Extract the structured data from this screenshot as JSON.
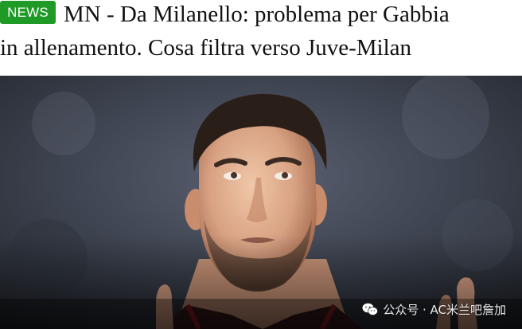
{
  "article": {
    "badge": "NEWS",
    "title_line1": "MN - Da Milanello: problema per Gabbia",
    "title_line2": "in allenamento. Cosa filtra verso Juve-Milan"
  },
  "photo": {
    "description_icon": "player-photo"
  },
  "watermark": {
    "text": "公众号 · AC米兰吧詹加",
    "icon": "wechat-icon"
  },
  "colors": {
    "badge_bg": "#1f9a26",
    "headline_text": "#111111"
  }
}
